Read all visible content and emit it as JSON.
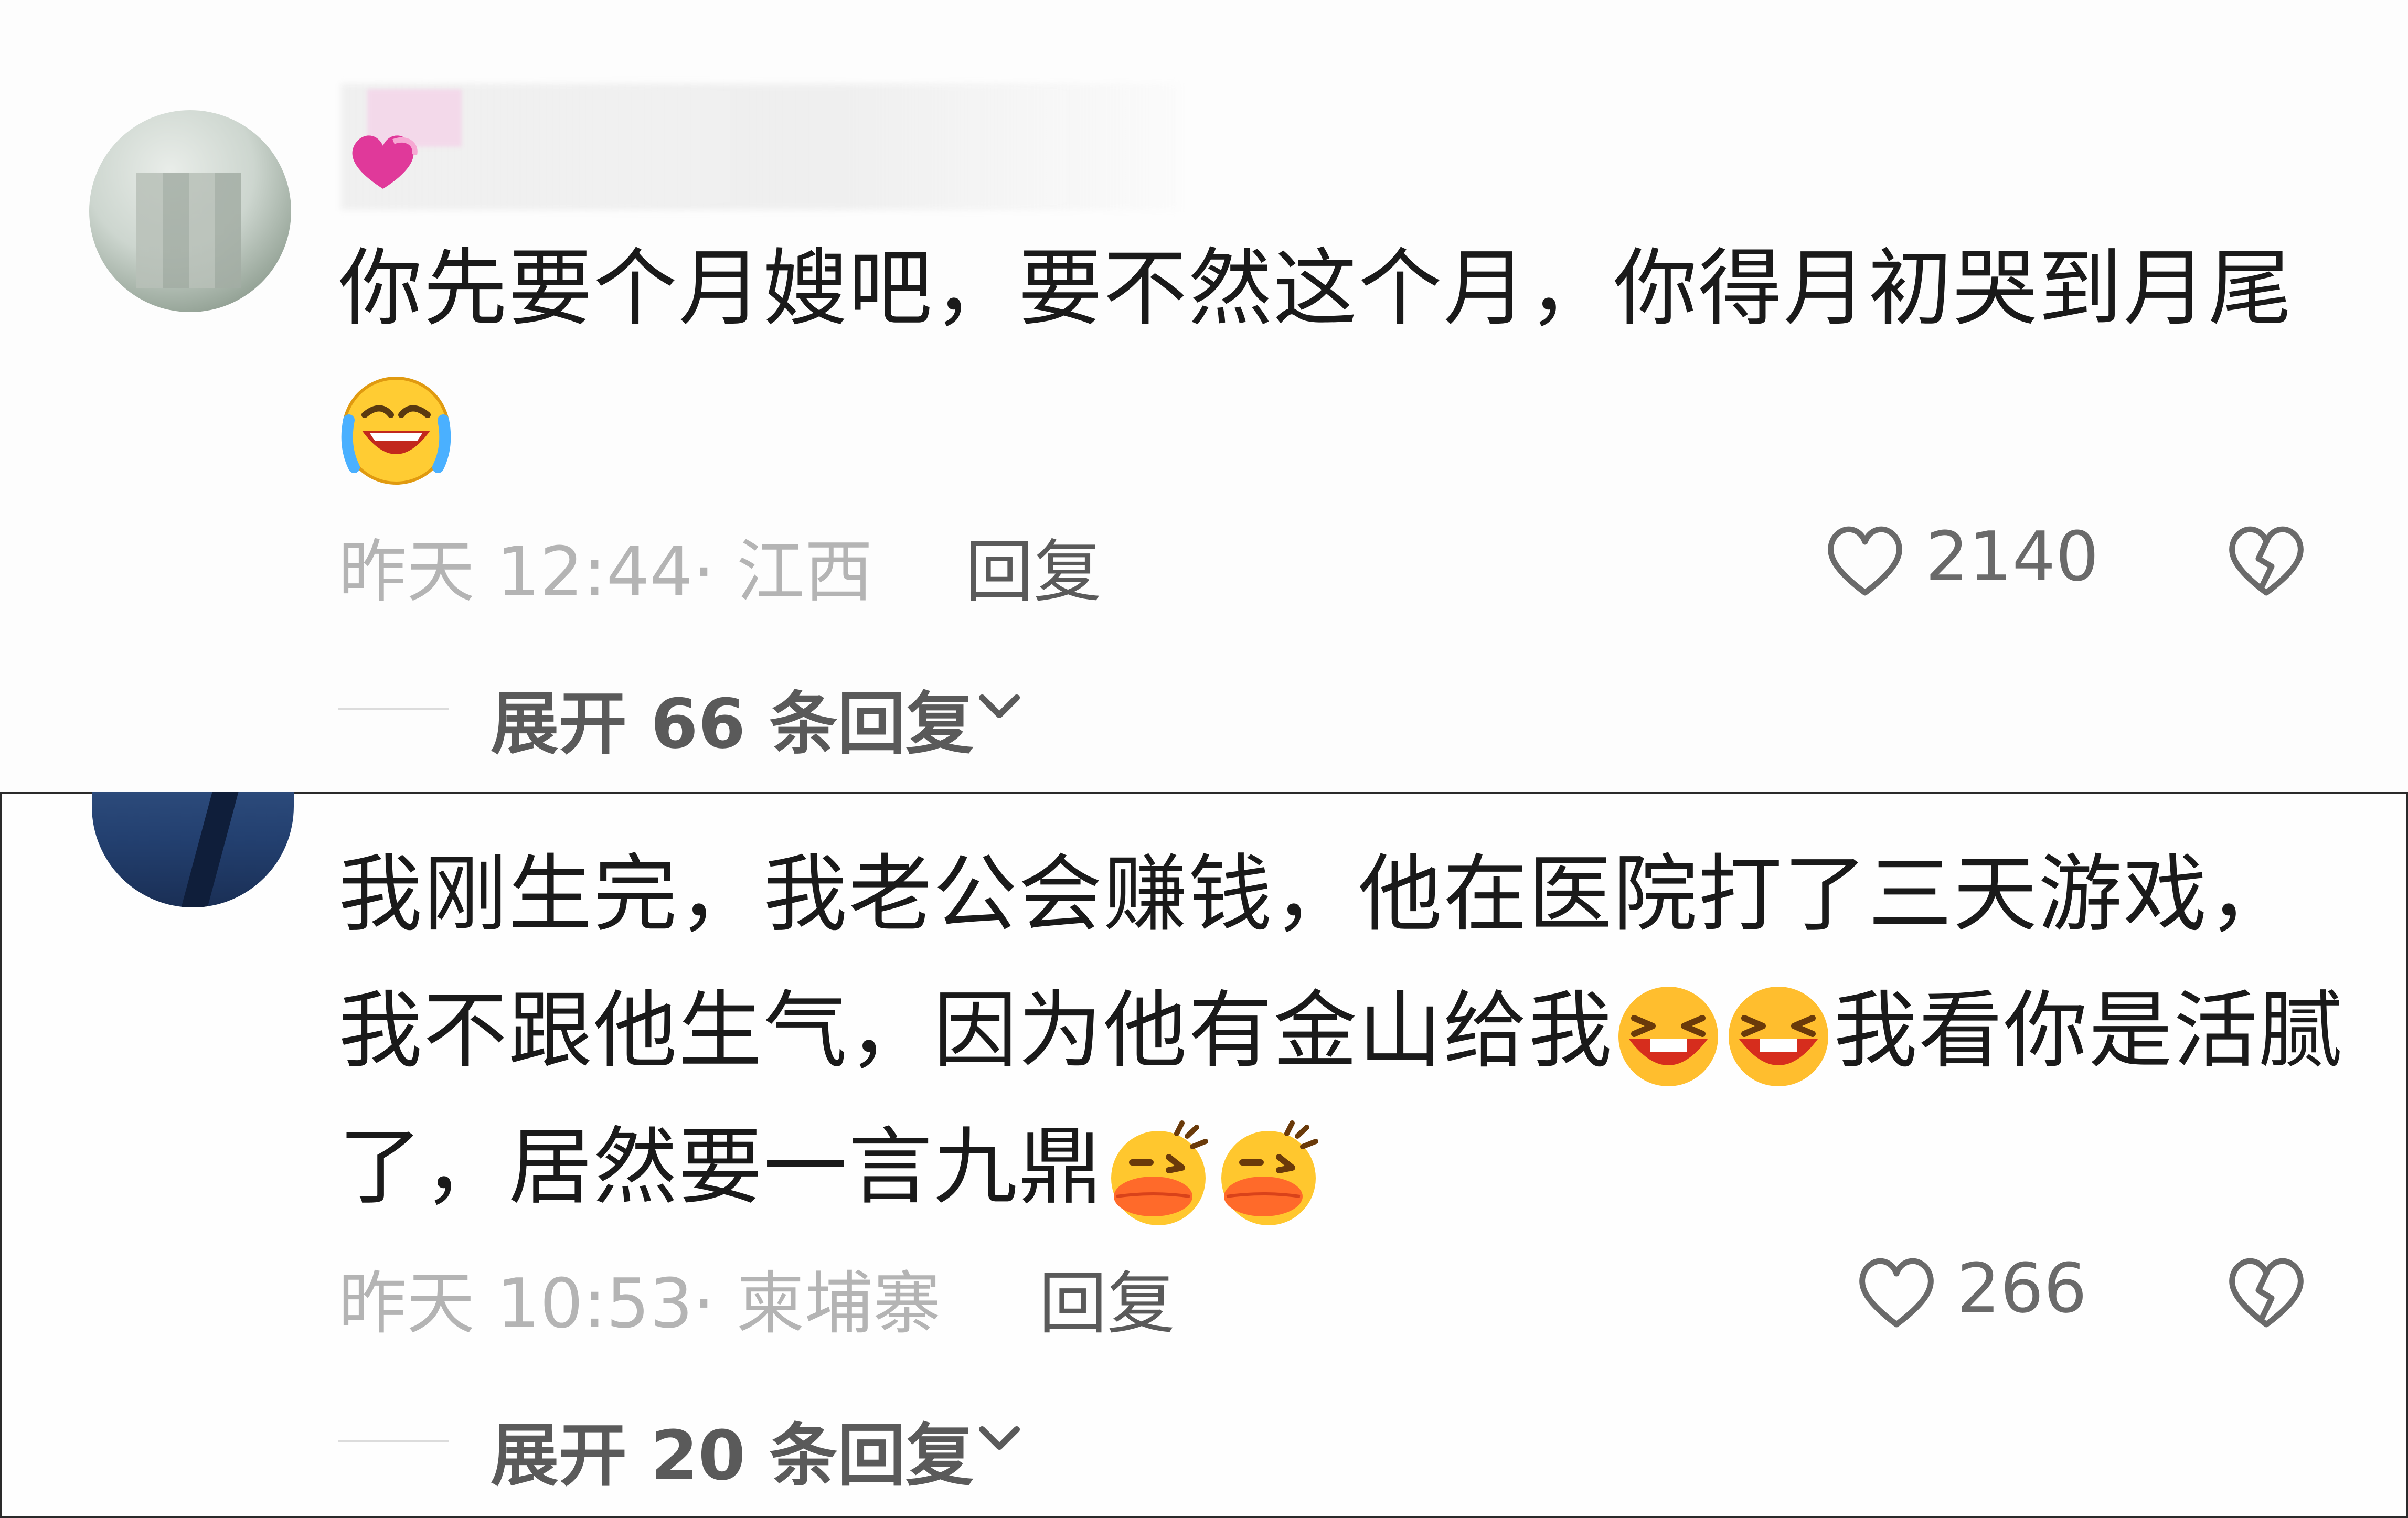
{
  "comments": [
    {
      "text": "你先要个月嫂吧，要不然这个月，你得月初哭到月尾",
      "time": "昨天 12:44",
      "location": "· 江西",
      "reply_label": "回复",
      "likes": "2140",
      "expand_label": "展开 66 条回复"
    },
    {
      "text_part1": "我刚生完，我老公会赚钱，他在医院打了三天游戏，我不跟他生气，因为他有金山给我",
      "text_part2": "我看你是活腻了，居然要一言九鼎",
      "time": "昨天 10:53",
      "location": "· 柬埔寨",
      "reply_label": "回复",
      "likes": "266",
      "expand_label": "展开 20 条回复"
    }
  ],
  "icons": {
    "badge": "heart-badge-icon",
    "emoji_1": "rofl-emoji",
    "emoji_2": "grin-laugh-emoji",
    "emoji_3": "duck-lips-emoji",
    "like": "heart-outline-icon",
    "dislike": "broken-heart-icon",
    "expand": "chevron-down-icon"
  },
  "colors": {
    "text": "#1a1a1a",
    "meta": "#b4b4b4",
    "action": "#5a5a5a",
    "badge_pink": "#e0399a"
  }
}
